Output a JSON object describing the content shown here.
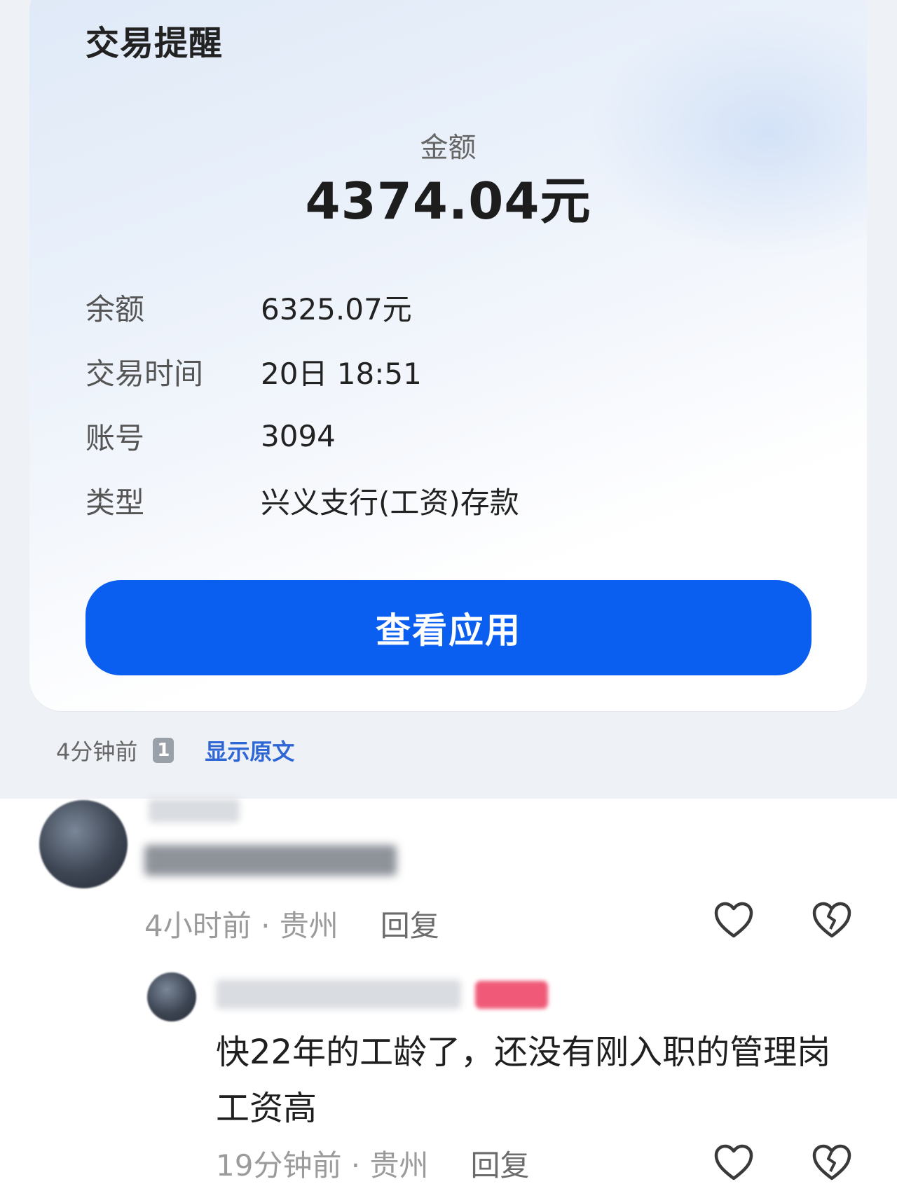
{
  "notification": {
    "title": "交易提醒",
    "amount_label": "金额",
    "amount_value": "4374.04元",
    "details": [
      {
        "key": "余额",
        "value": "6325.07元"
      },
      {
        "key": "交易时间",
        "value": "20日 18:51"
      },
      {
        "key": "账号",
        "value": "3094"
      },
      {
        "key": "类型",
        "value": "兴义支行(工资)存款"
      }
    ],
    "button_label": "查看应用",
    "time_ago": "4分钟前",
    "badge_count": "1",
    "show_original": "显示原文"
  },
  "comments": [
    {
      "time": "4小时前 · 贵州",
      "reply_label": "回复"
    },
    {
      "text": "快22年的工龄了，还没有刚入职的管理岗工资高",
      "time": "19分钟前 · 贵州",
      "reply_label": "回复"
    }
  ],
  "colors": {
    "button_blue": "#0a5ff0",
    "link_blue": "#2f66d6",
    "tag_pink": "#f05a78"
  },
  "icons": [
    "heart-icon",
    "broken-heart-icon"
  ]
}
